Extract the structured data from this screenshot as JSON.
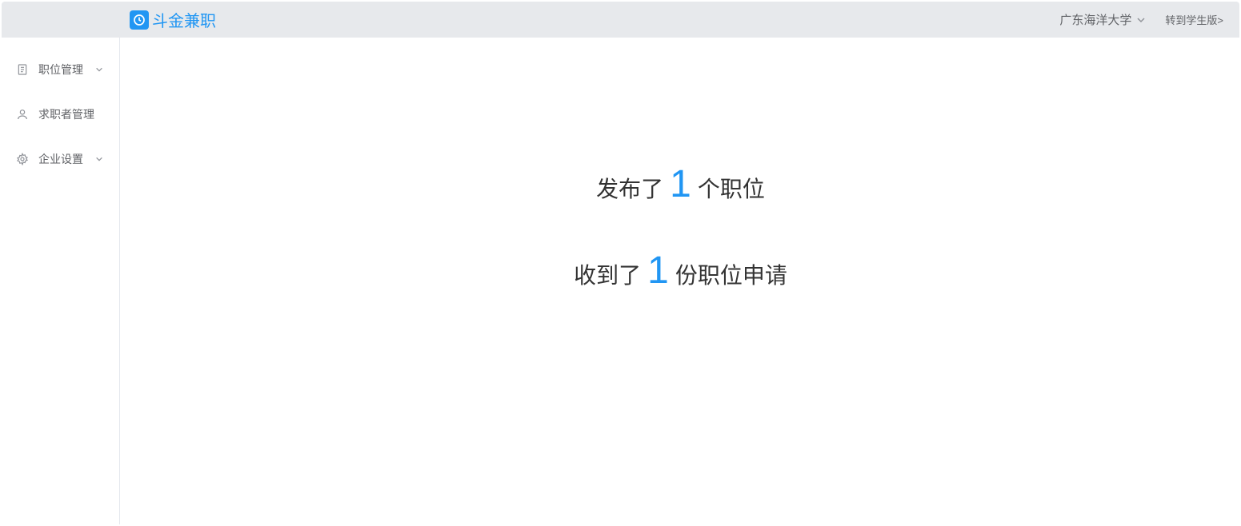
{
  "header": {
    "logo_text": "斗金兼职",
    "university": "广东海洋大学",
    "switch_link": "转到学生版>"
  },
  "sidebar": {
    "items": [
      {
        "label": "职位管理",
        "has_children": true
      },
      {
        "label": "求职者管理",
        "has_children": false
      },
      {
        "label": "企业设置",
        "has_children": true
      }
    ]
  },
  "main": {
    "stat1_prefix": "发布了",
    "stat1_number": "1",
    "stat1_suffix": "个职位",
    "stat2_prefix": "收到了",
    "stat2_number": "1",
    "stat2_suffix": "份职位申请"
  }
}
